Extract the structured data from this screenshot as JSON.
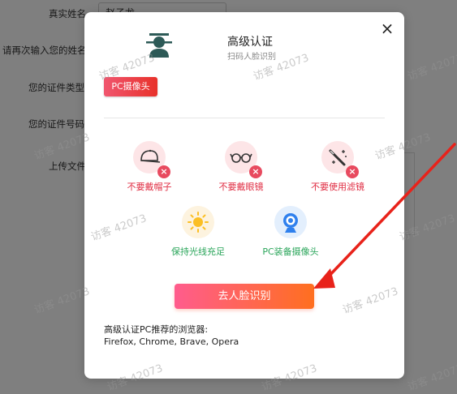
{
  "form": {
    "real_name_label": "真实姓名",
    "real_name_value": "赵子龙",
    "reenter_name_label": "请再次输入您的姓名",
    "id_type_label": "您的证件类型",
    "id_number_label": "您的证件号码",
    "upload_label": "上传文件"
  },
  "watermark": "访客 42073",
  "modal": {
    "close_label": "×",
    "title": "高级认证",
    "subtitle": "扫码人脸识别",
    "tag": "PC摄像头",
    "tips": [
      {
        "label": "不要戴帽子",
        "icon": "cap-icon"
      },
      {
        "label": "不要戴眼镜",
        "icon": "glasses-icon"
      },
      {
        "label": "不要使用滤镜",
        "icon": "filter-wand-icon"
      },
      {
        "label": "保持光线充足",
        "icon": "sun-icon"
      },
      {
        "label": "PC装备摄像头",
        "icon": "webcam-icon"
      }
    ],
    "cta_label": "去人脸识别",
    "browser_title": "高级认证PC推荐的浏览器:",
    "browser_list": "Firefox, Chrome, Brave, Opera"
  },
  "colors": {
    "accent_red": "#e02d43",
    "accent_green": "#2aa55a",
    "cta_start": "#ff5c8d",
    "cta_end": "#ff6f1f"
  }
}
